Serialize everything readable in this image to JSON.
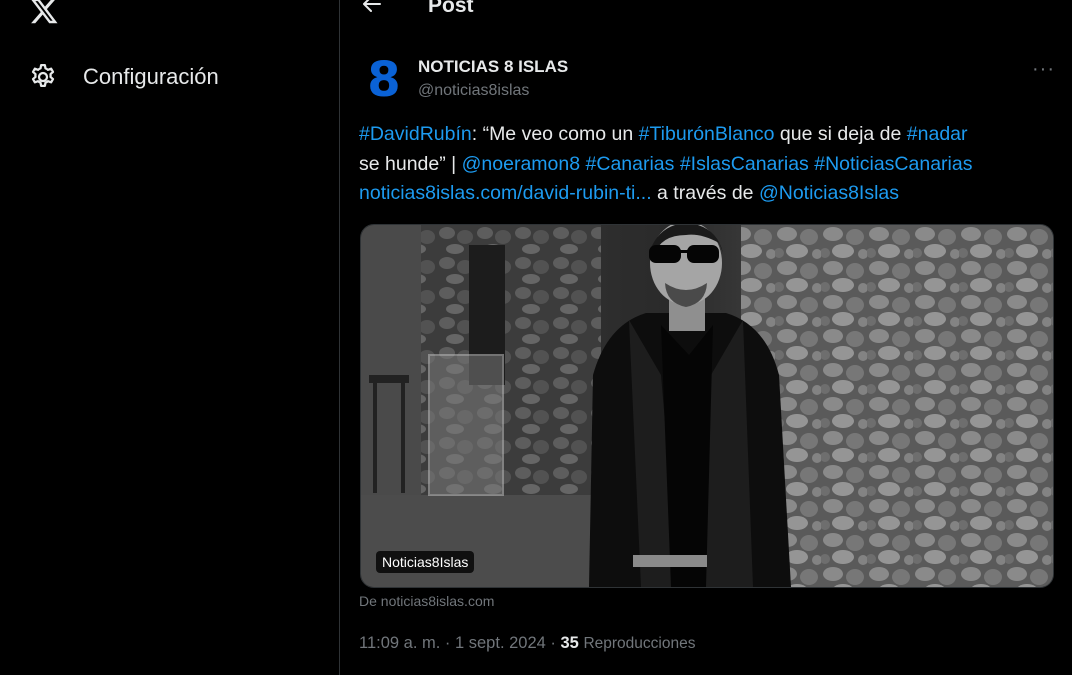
{
  "sidebar": {
    "logo": "x-logo-icon",
    "items": [
      {
        "icon": "gear-icon",
        "label": "Configuración"
      }
    ]
  },
  "header": {
    "back_icon": "arrow-left-icon",
    "title": "Post"
  },
  "post": {
    "avatar_text": "8",
    "author_name": "NOTICIAS 8 ISLAS",
    "author_handle": "@noticias8islas",
    "more_label": "···",
    "text": {
      "hashtag_davidrubin": "#DavidRubín",
      "quote_part1": ": “Me veo como un ",
      "hashtag_tiburon": "#TiburónBlanco",
      "quote_part2": " que si deja de ",
      "hashtag_nadar": "#nadar",
      "quote_part3": "se hunde” | ",
      "mention_noeramon8": "@noeramon8",
      "hashtag_canarias": "#Canarias",
      "hashtag_islascanarias": "#IslasCanarias",
      "hashtag_noticiascanarias": "#NoticiasCanarias",
      "link_url": "noticias8islas.com/david-rubin-ti...",
      "via_text": " a través de ",
      "mention_noticias8islas": "@Noticias8Islas"
    },
    "media_tag": "Noticias8Islas",
    "source": "De noticias8islas.com",
    "meta": {
      "time": "11:09 a. m.",
      "separator": " · ",
      "date": "1 sept. 2024",
      "views_count": "35",
      "views_label": "Reproducciones"
    }
  },
  "colors": {
    "background": "#000000",
    "text": "#e7e9ea",
    "secondary": "#71767b",
    "link": "#1d9bf0",
    "avatar": "#0a62d6",
    "border": "#2f3336"
  }
}
